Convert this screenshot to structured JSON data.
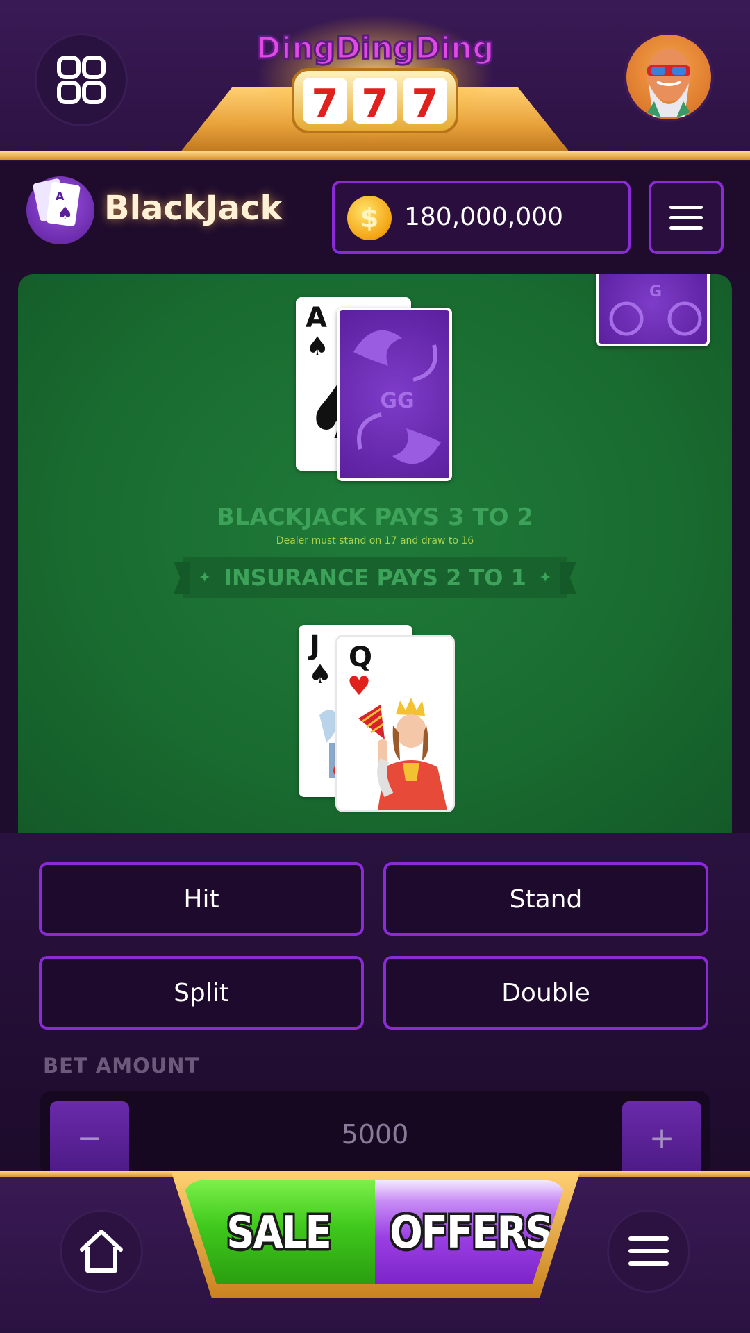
{
  "topbar": {
    "logo_text": "DingDingDing",
    "logo_reels": [
      "7",
      "7",
      "7"
    ],
    "grid_icon": "grid-icon",
    "avatar_icon": "avatar"
  },
  "game_header": {
    "title": "BlackJack",
    "balance": "180,000,000",
    "coin_symbol": "$",
    "menu_icon": "hamburger-icon"
  },
  "table": {
    "dealer_cards": [
      {
        "rank": "A",
        "suit": "♠",
        "face": "up"
      },
      {
        "face": "down"
      }
    ],
    "player_cards": [
      {
        "rank": "J",
        "suit": "♠",
        "face": "up"
      },
      {
        "rank": "Q",
        "suit": "♥",
        "face": "up"
      }
    ],
    "blackjack_text": "BLACKJACK PAYS 3 TO 2",
    "dealer_rule_text": "Dealer must stand on 17 and draw to 16",
    "insurance_text": "INSURANCE PAYS 2 TO 1"
  },
  "controls": {
    "hit_label": "Hit",
    "stand_label": "Stand",
    "split_label": "Split",
    "double_label": "Double",
    "bet_label": "BET AMOUNT",
    "bet_value": "5000",
    "minus_label": "−",
    "plus_label": "+"
  },
  "bottom_nav": {
    "home_icon": "home-icon",
    "sale_label": "SALE",
    "offers_label": "OFFERS",
    "menu_icon": "hamburger-icon"
  },
  "colors": {
    "accent_purple": "#8a2bd6",
    "table_green": "#196b30",
    "gold": "#e8a23a",
    "sale_green": "#3fc81c"
  }
}
